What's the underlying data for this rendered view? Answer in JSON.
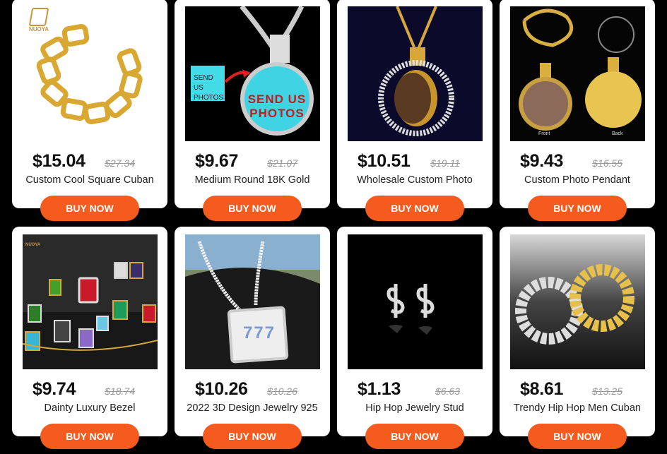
{
  "products": [
    {
      "price": "$15.04",
      "old_price": "$27.34",
      "title": "Custom Cool Square Cuban",
      "button": "BUY NOW",
      "image": "gold-chain-bracelet",
      "brand": "NUOYA"
    },
    {
      "price": "$9.67",
      "old_price": "$21.07",
      "title": "Medium Round 18K Gold",
      "button": "BUY NOW",
      "image": "photo-pendant-necklace",
      "overlay_small": "SEND US PHOTOS",
      "overlay_big_1": "SEND US",
      "overlay_big_2": "PHOTOS"
    },
    {
      "price": "$10.51",
      "old_price": "$19.11",
      "title": "Wholesale Custom Photo",
      "button": "BUY NOW",
      "image": "spinning-photo-pendant"
    },
    {
      "price": "$9.43",
      "old_price": "$16.55",
      "title": "Custom Photo Pendant",
      "button": "BUY NOW",
      "image": "photo-pendant-set",
      "label_front": "Front",
      "label_back": "Back"
    },
    {
      "price": "$9.74",
      "old_price": "$18.74",
      "title": "Dainty Luxury Bezel",
      "button": "BUY NOW",
      "image": "gem-pendants",
      "brand": "NUOYA"
    },
    {
      "price": "$10.26",
      "old_price": "$10.26",
      "title": "2022 3D Design Jewelry 925",
      "button": "BUY NOW",
      "image": "777-pendant",
      "pendant_text": "777"
    },
    {
      "price": "$1.13",
      "old_price": "$6.63",
      "title": "Hip Hop Jewelry Stud",
      "button": "BUY NOW",
      "image": "dollar-stud-earrings"
    },
    {
      "price": "$8.61",
      "old_price": "$13.25",
      "title": "Trendy Hip Hop Men Cuban",
      "button": "BUY NOW",
      "image": "cuban-rings"
    }
  ],
  "colors": {
    "button": "#f55a1f",
    "background": "#000000",
    "card": "#ffffff"
  }
}
